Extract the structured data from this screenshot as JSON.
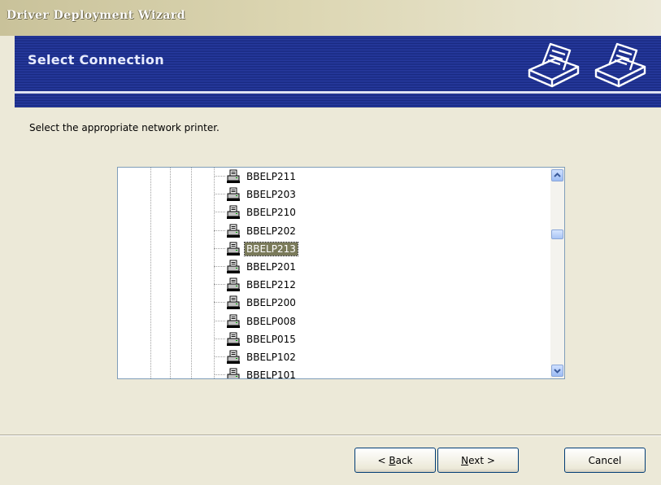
{
  "window": {
    "title": "Driver Deployment Wizard"
  },
  "header": {
    "title": "Select Connection",
    "icons": [
      "printer-icon",
      "printer-icon"
    ]
  },
  "instruction": "Select the appropriate network printer.",
  "printer_list": {
    "selected": "BBELP213",
    "items": [
      {
        "label": "BBELP211",
        "icon": "printer-icon"
      },
      {
        "label": "BBELP203",
        "icon": "printer-icon"
      },
      {
        "label": "BBELP210",
        "icon": "printer-icon"
      },
      {
        "label": "BBELP202",
        "icon": "printer-icon"
      },
      {
        "label": "BBELP213",
        "icon": "printer-icon"
      },
      {
        "label": "BBELP201",
        "icon": "printer-icon"
      },
      {
        "label": "BBELP212",
        "icon": "printer-icon"
      },
      {
        "label": "BBELP200",
        "icon": "printer-icon"
      },
      {
        "label": "BBELP008",
        "icon": "printer-icon"
      },
      {
        "label": "BBELP015",
        "icon": "printer-icon"
      },
      {
        "label": "BBELP102",
        "icon": "printer-icon"
      },
      {
        "label": "BBELP101",
        "icon": "printer-icon"
      }
    ]
  },
  "buttons": {
    "back": {
      "prefix": "< ",
      "mnemonic": "B",
      "rest": "ack"
    },
    "next": {
      "mnemonic": "N",
      "rest": "ext",
      "suffix": " >"
    },
    "cancel": "Cancel"
  }
}
